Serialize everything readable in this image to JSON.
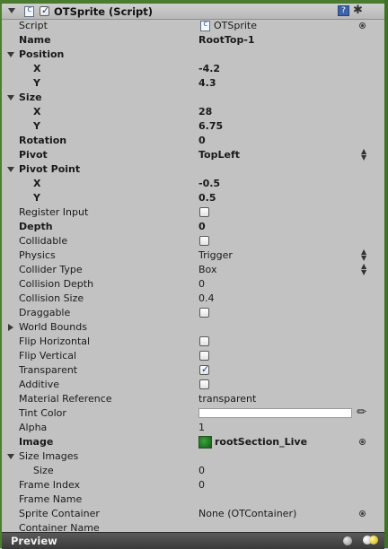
{
  "component": {
    "title": "OTSprite (Script)",
    "enabled": true,
    "script_value": "OTSprite"
  },
  "fields": {
    "script": "Script",
    "name": "Name",
    "name_value": "RootTop-1",
    "position": "Position",
    "pos_x": "X",
    "pos_x_value": "-4.2",
    "pos_y": "Y",
    "pos_y_value": "4.3",
    "size": "Size",
    "size_x": "X",
    "size_x_value": "28",
    "size_y": "Y",
    "size_y_value": "6.75",
    "rotation": "Rotation",
    "rotation_value": "0",
    "pivot": "Pivot",
    "pivot_value": "TopLeft",
    "pivot_point": "Pivot Point",
    "pp_x": "X",
    "pp_x_value": "-0.5",
    "pp_y": "Y",
    "pp_y_value": "0.5",
    "register_input": "Register Input",
    "register_input_checked": false,
    "depth": "Depth",
    "depth_value": "0",
    "collidable": "Collidable",
    "collidable_checked": false,
    "physics": "Physics",
    "physics_value": "Trigger",
    "collider_type": "Collider Type",
    "collider_type_value": "Box",
    "collision_depth": "Collision Depth",
    "collision_depth_value": "0",
    "collision_size": "Collision Size",
    "collision_size_value": "0.4",
    "draggable": "Draggable",
    "draggable_checked": false,
    "world_bounds": "World Bounds",
    "flip_horizontal": "Flip Horizontal",
    "flip_horizontal_checked": false,
    "flip_vertical": "Flip Vertical",
    "flip_vertical_checked": false,
    "transparent": "Transparent",
    "transparent_checked": true,
    "additive": "Additive",
    "additive_checked": false,
    "material_reference": "Material Reference",
    "material_reference_value": "transparent",
    "tint_color": "Tint Color",
    "tint_color_value": "#ffffff",
    "alpha": "Alpha",
    "alpha_value": "1",
    "image": "Image",
    "image_value": "rootSection_Live",
    "size_images": "Size Images",
    "size_images_size": "Size",
    "size_images_size_value": "0",
    "frame_index": "Frame Index",
    "frame_index_value": "0",
    "frame_name": "Frame Name",
    "sprite_container": "Sprite Container",
    "sprite_container_value": "None (OTContainer)",
    "container_name": "Container Name"
  },
  "preview": {
    "title": "Preview"
  },
  "colors": {
    "frame_green": "#4b7b2e",
    "panel_bg": "#c2c2c2",
    "preview_bar": "#4a4a4a",
    "check_blue": "#1c3f7a"
  }
}
